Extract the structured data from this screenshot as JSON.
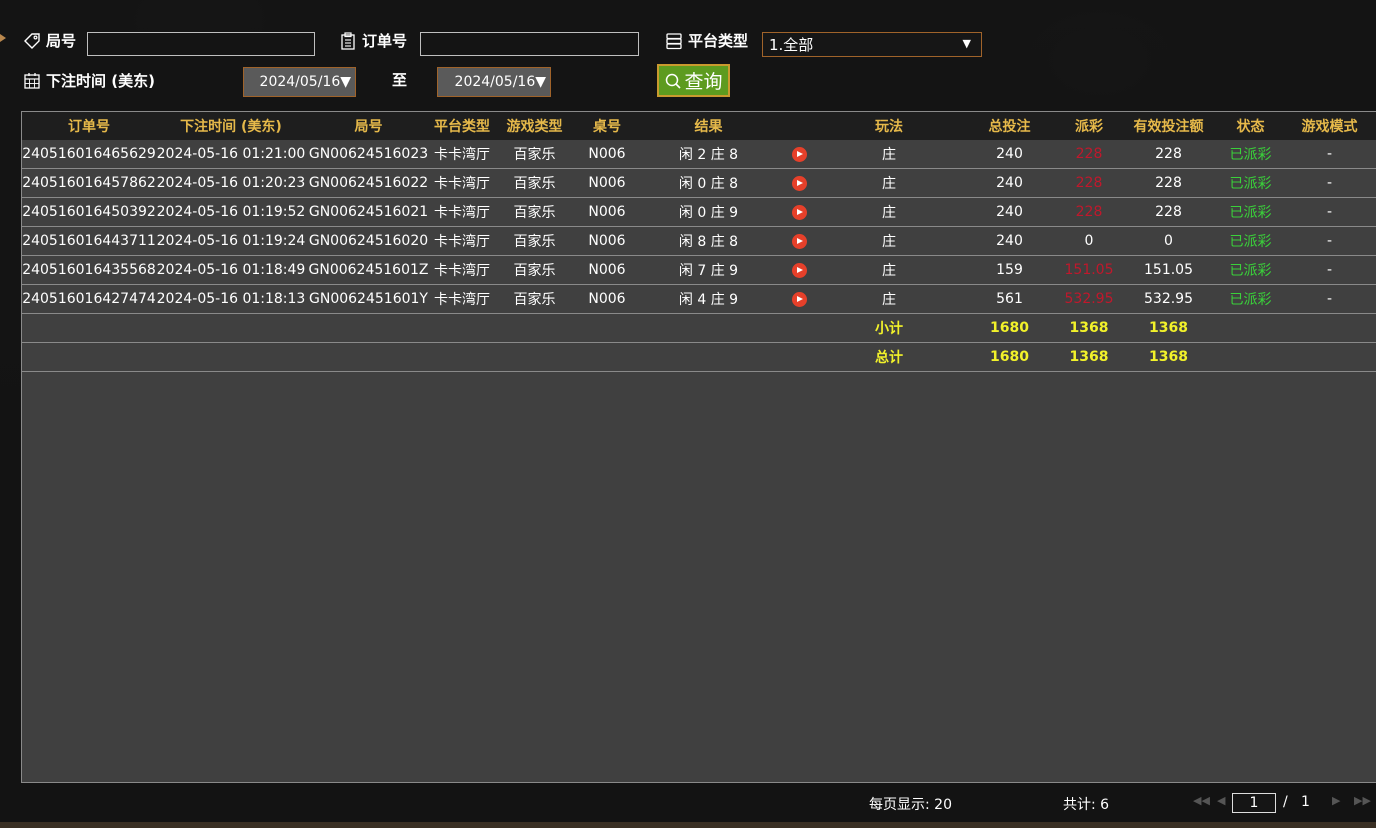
{
  "filters": {
    "round_label": "局号",
    "round_value": "",
    "order_label": "订单号",
    "order_value": "",
    "platform_label": "平台类型",
    "platform_selected": "1.全部",
    "bet_time_label": "下注时间 (美东)",
    "date_from": "2024/05/16▼",
    "to_label": "至",
    "date_to": "2024/05/16▼",
    "query_label": "查询"
  },
  "table": {
    "columns": [
      "订单号",
      "下注时间 (美东)",
      "局号",
      "平台类型",
      "游戏类型",
      "桌号",
      "结果",
      "",
      "玩法",
      "总投注",
      "派彩",
      "有效投注额",
      "状态",
      "游戏模式"
    ],
    "rows": [
      {
        "order": "240516016465629",
        "time": "2024-05-16 01:21:00",
        "round": "GN00624516023",
        "platform": "卡卡湾厅",
        "game": "百家乐",
        "table": "N006",
        "result": "闲 2 庄 8",
        "play": "庄",
        "bet": "240",
        "payout": "228",
        "valid": "228",
        "status": "已派彩",
        "mode": "-"
      },
      {
        "order": "240516016457862",
        "time": "2024-05-16 01:20:23",
        "round": "GN00624516022",
        "platform": "卡卡湾厅",
        "game": "百家乐",
        "table": "N006",
        "result": "闲 0 庄 8",
        "play": "庄",
        "bet": "240",
        "payout": "228",
        "valid": "228",
        "status": "已派彩",
        "mode": "-"
      },
      {
        "order": "240516016450392",
        "time": "2024-05-16 01:19:52",
        "round": "GN00624516021",
        "platform": "卡卡湾厅",
        "game": "百家乐",
        "table": "N006",
        "result": "闲 0 庄 9",
        "play": "庄",
        "bet": "240",
        "payout": "228",
        "valid": "228",
        "status": "已派彩",
        "mode": "-"
      },
      {
        "order": "240516016443711",
        "time": "2024-05-16 01:19:24",
        "round": "GN00624516020",
        "platform": "卡卡湾厅",
        "game": "百家乐",
        "table": "N006",
        "result": "闲 8 庄 8",
        "play": "庄",
        "bet": "240",
        "payout": "0",
        "valid": "0",
        "status": "已派彩",
        "mode": "-"
      },
      {
        "order": "240516016435568",
        "time": "2024-05-16 01:18:49",
        "round": "GN0062451601Z",
        "platform": "卡卡湾厅",
        "game": "百家乐",
        "table": "N006",
        "result": "闲 7 庄 9",
        "play": "庄",
        "bet": "159",
        "payout": "151.05",
        "valid": "151.05",
        "status": "已派彩",
        "mode": "-"
      },
      {
        "order": "240516016427474",
        "time": "2024-05-16 01:18:13",
        "round": "GN0062451601Y",
        "platform": "卡卡湾厅",
        "game": "百家乐",
        "table": "N006",
        "result": "闲 4 庄 9",
        "play": "庄",
        "bet": "561",
        "payout": "532.95",
        "valid": "532.95",
        "status": "已派彩",
        "mode": "-"
      }
    ],
    "subtotal": {
      "label": "小计",
      "bet": "1680",
      "payout": "1368",
      "valid": "1368"
    },
    "total": {
      "label": "总计",
      "bet": "1680",
      "payout": "1368",
      "valid": "1368"
    }
  },
  "footer": {
    "per_page": "每页显示: 20",
    "count": "共计: 6",
    "page_current": "1",
    "page_sep": "/",
    "page_total": "1"
  },
  "colors": {
    "header_text": "#e6b94a",
    "sum_text": "#f2f22a",
    "status_green": "#3ad13a",
    "payout_red": "#c0182c",
    "query_button": "#5d9b1f"
  }
}
